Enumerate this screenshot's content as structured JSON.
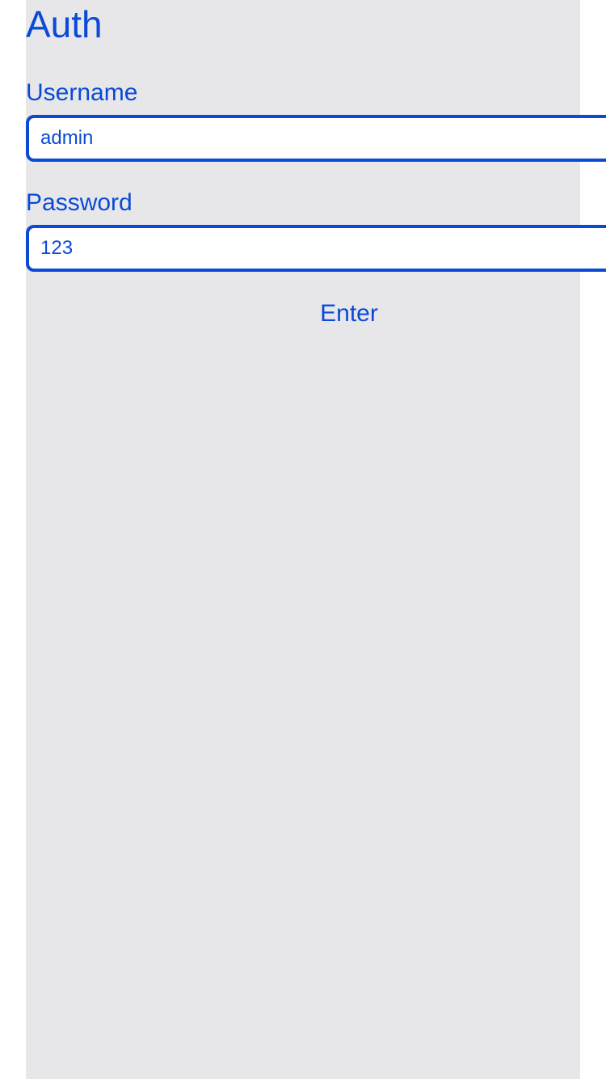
{
  "page": {
    "title": "Auth"
  },
  "form": {
    "username_label": "Username",
    "username_value": "admin",
    "password_label": "Password",
    "password_value": "123",
    "submit_label": "Enter"
  },
  "colors": {
    "accent": "#0a4ad6",
    "panel_background": "#e7e7ea",
    "page_background": "#ffffff"
  }
}
